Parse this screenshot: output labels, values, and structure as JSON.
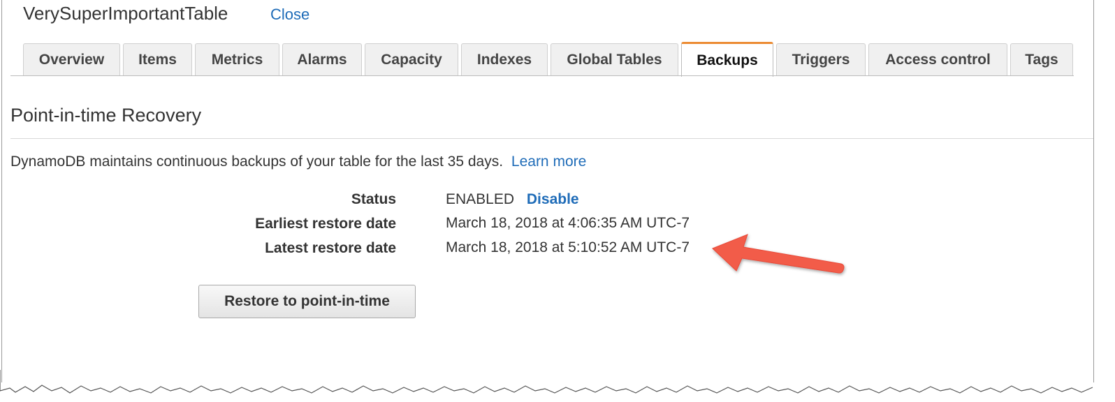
{
  "header": {
    "table_name": "VerySuperImportantTable",
    "close_label": "Close"
  },
  "tabs": [
    {
      "label": "Overview",
      "active": false
    },
    {
      "label": "Items",
      "active": false
    },
    {
      "label": "Metrics",
      "active": false
    },
    {
      "label": "Alarms",
      "active": false
    },
    {
      "label": "Capacity",
      "active": false
    },
    {
      "label": "Indexes",
      "active": false
    },
    {
      "label": "Global Tables",
      "active": false
    },
    {
      "label": "Backups",
      "active": true
    },
    {
      "label": "Triggers",
      "active": false
    },
    {
      "label": "Access control",
      "active": false
    },
    {
      "label": "Tags",
      "active": false
    }
  ],
  "section": {
    "title": "Point-in-time Recovery",
    "description": "DynamoDB maintains continuous backups of your table for the last 35 days.",
    "learn_more_label": "Learn more"
  },
  "status": {
    "label": "Status",
    "value": "ENABLED",
    "disable_label": "Disable"
  },
  "earliest_restore": {
    "label": "Earliest restore date",
    "value": "March 18, 2018 at 4:06:35 AM UTC-7"
  },
  "latest_restore": {
    "label": "Latest restore date",
    "value": "March 18, 2018 at 5:10:52 AM UTC-7"
  },
  "restore_button_label": "Restore to point-in-time",
  "colors": {
    "link": "#1f6cb8",
    "active_tab_accent": "#ec8b32",
    "annotation_arrow": "#f25c4a"
  },
  "annotation": {
    "icon": "red-arrow-icon"
  }
}
